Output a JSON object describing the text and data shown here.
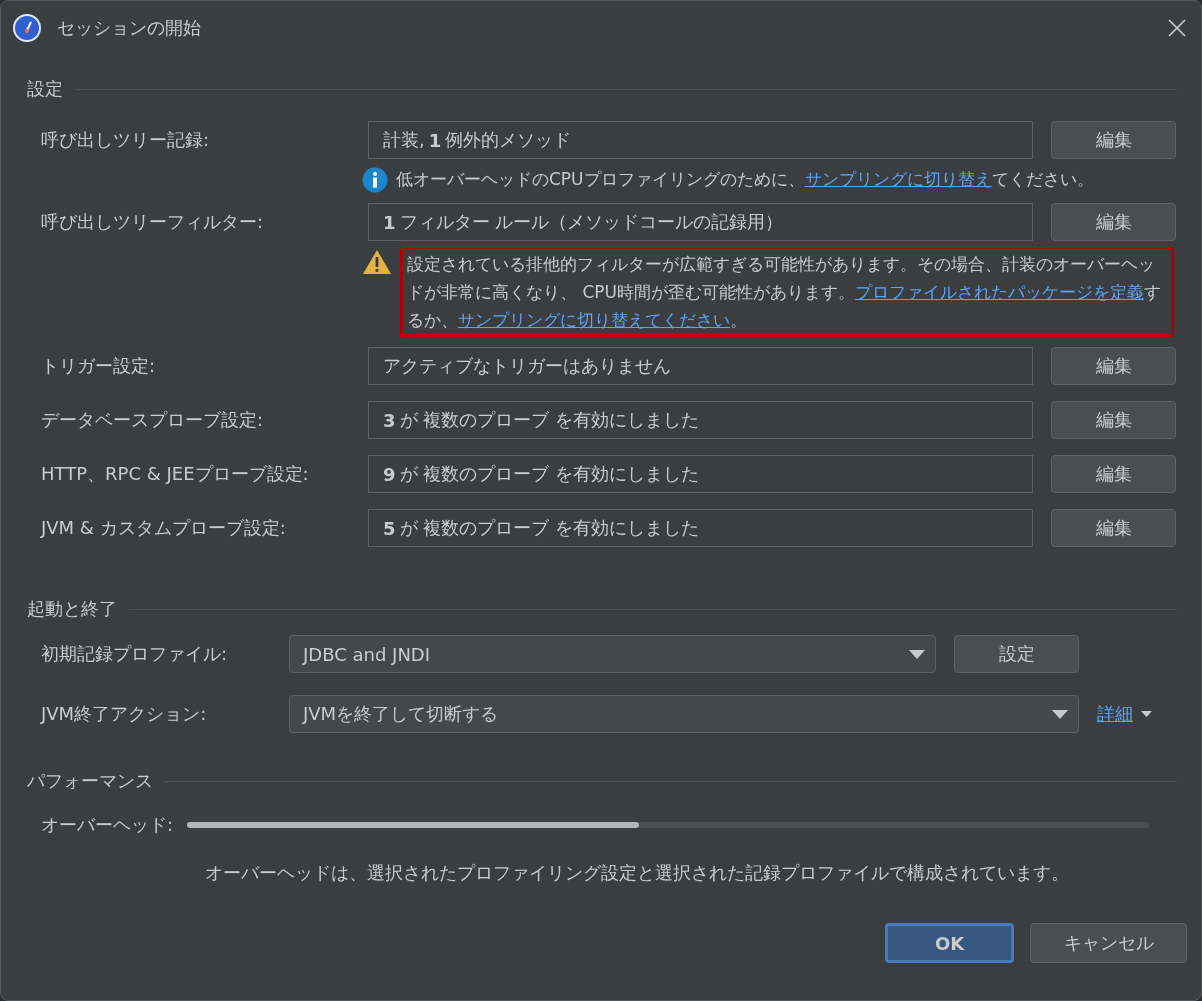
{
  "window": {
    "title": "セッションの開始"
  },
  "settings": {
    "heading": "設定",
    "rows": [
      {
        "label": "呼び出しツリー記録:",
        "value": "計装, **1** 例外的メソッド",
        "button": "編集",
        "note": {
          "kind": "info",
          "parts": [
            {
              "kind": "text",
              "text": "低オーバーヘッドのCPUプロファイリングのために、"
            },
            {
              "kind": "link",
              "text": "サンプリングに切り替え"
            },
            {
              "kind": "text",
              "text": "てください。"
            }
          ]
        }
      },
      {
        "label": "呼び出しツリーフィルター:",
        "value": "**1** フィルター ルール（メソッドコールの記録用）",
        "button": "編集",
        "note": {
          "kind": "warning",
          "parts": [
            {
              "kind": "text",
              "text": "設定されている排他的フィルターが広範すぎる可能性があります。その場合、計装のオーバーヘッドが非常に高くなり、 CPU時間が歪む可能性があります。"
            },
            {
              "kind": "link",
              "text": "プロファイルされたパッケージを定義"
            },
            {
              "kind": "text",
              "text": "するか、"
            },
            {
              "kind": "link",
              "text": "サンプリングに切り替えてください"
            },
            {
              "kind": "text",
              "text": "。"
            }
          ]
        }
      },
      {
        "label": "トリガー設定:",
        "value": "アクティブなトリガーはありません",
        "button": "編集"
      },
      {
        "label": "データベースプローブ設定:",
        "value": "**3** が 複数のプローブ を有効にしました",
        "button": "編集"
      },
      {
        "label": "HTTP、RPC & JEEプローブ設定:",
        "value": "**9** が 複数のプローブ を有効にしました",
        "button": "編集"
      },
      {
        "label": "JVM & カスタムプローブ設定:",
        "value": "**5** が 複数のプローブ を有効にしました",
        "button": "編集"
      }
    ]
  },
  "startup": {
    "heading": "起動と終了",
    "profile": {
      "label": "初期記録プロファイル:",
      "value": "JDBC and JNDI",
      "button": "設定"
    },
    "exit": {
      "label": "JVM終了アクション:",
      "value": "JVMを終了して切断する",
      "link": "詳細"
    }
  },
  "performance": {
    "heading": "パフォーマンス",
    "label": "オーバーヘッド:",
    "level": 0.47,
    "description": "オーバーヘッドは、選択されたプロファイリング設定と選択された記録プロファイルで構成されています。"
  },
  "buttons": [
    {
      "label": "OK",
      "kind": "primary"
    },
    {
      "label": "キャンセル",
      "kind": "secondary"
    }
  ]
}
